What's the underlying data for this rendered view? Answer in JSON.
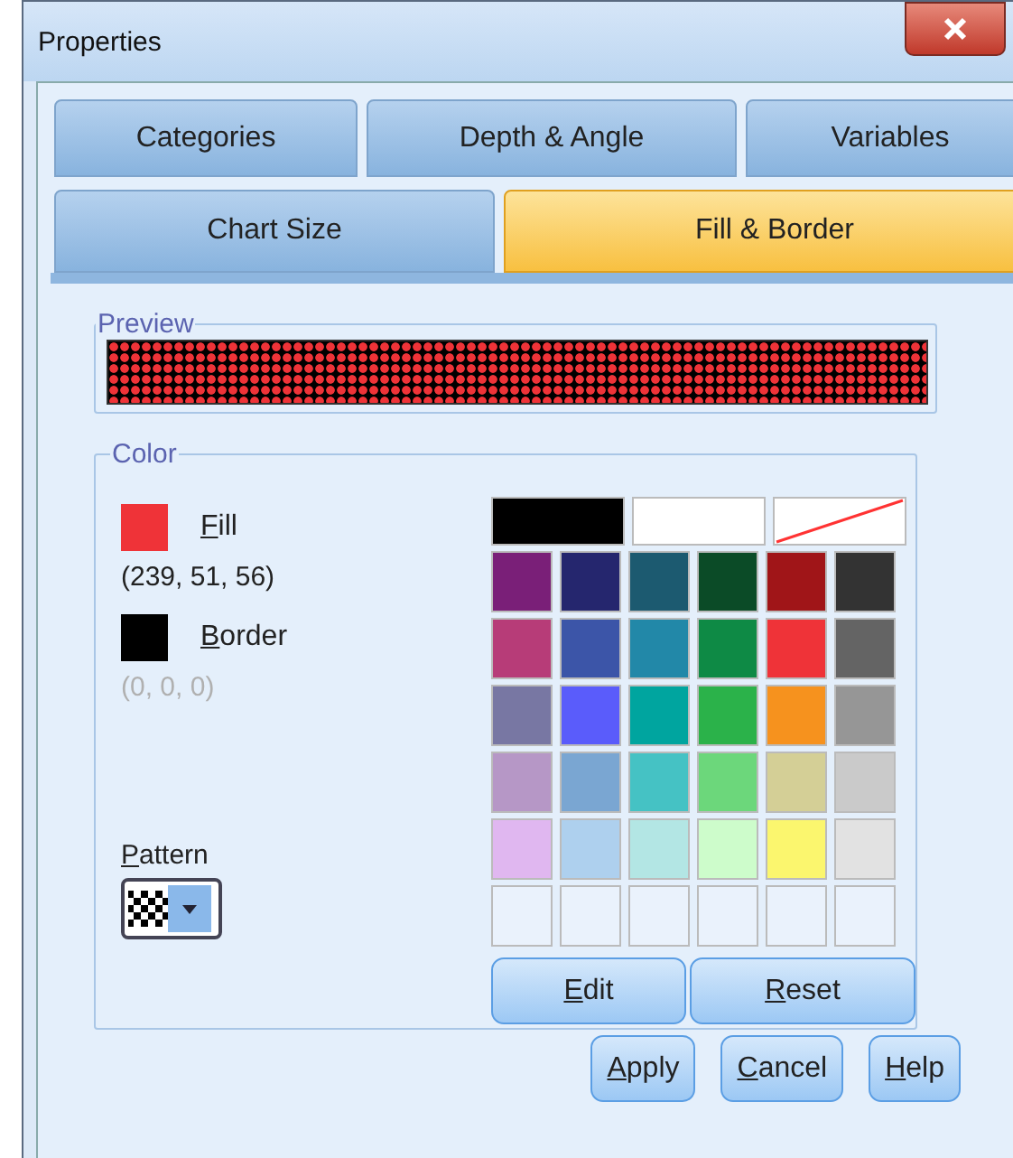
{
  "window": {
    "title": "Properties"
  },
  "tab_rows": [
    [
      {
        "label": "Categories",
        "selected": false
      },
      {
        "label": "Depth & Angle",
        "selected": false
      },
      {
        "label": "Variables",
        "selected": false
      }
    ],
    [
      {
        "label": "Chart Size",
        "selected": false
      },
      {
        "label": "Fill & Border",
        "selected": true
      }
    ]
  ],
  "preview": {
    "title": "Preview",
    "layers": [
      {
        "kind": "ground",
        "color": "#000000"
      },
      {
        "kind": "dots",
        "color": "#ef3338"
      }
    ]
  },
  "color_group": {
    "title": "Color",
    "targets": [
      {
        "label": "Fill",
        "color": "#ef3338",
        "value": "(239, 51, 56)",
        "dimmed": false
      },
      {
        "label": "Border",
        "color": "#000000",
        "value": "(0, 0, 0)",
        "dimmed": true
      }
    ],
    "pattern": {
      "label": "Pattern"
    },
    "palette": [
      [
        {
          "kind": "wide",
          "color": "#000000"
        },
        {
          "kind": "wide",
          "color": "#ffffff"
        },
        {
          "kind": "none"
        }
      ],
      [
        {
          "kind": "swatch",
          "color": "#7a1f78"
        },
        {
          "kind": "swatch",
          "color": "#25266e"
        },
        {
          "kind": "swatch",
          "color": "#1c5a70"
        },
        {
          "kind": "swatch",
          "color": "#0b4b27"
        },
        {
          "kind": "swatch",
          "color": "#a01518"
        },
        {
          "kind": "swatch",
          "color": "#333333"
        }
      ],
      [
        {
          "kind": "swatch",
          "color": "#b73c78"
        },
        {
          "kind": "swatch",
          "color": "#3c55a8"
        },
        {
          "kind": "swatch",
          "color": "#2288a8"
        },
        {
          "kind": "swatch",
          "color": "#0e8a45"
        },
        {
          "kind": "swatch",
          "color": "#ef3338"
        },
        {
          "kind": "swatch",
          "color": "#646464"
        }
      ],
      [
        {
          "kind": "swatch",
          "color": "#7877a3"
        },
        {
          "kind": "swatch",
          "color": "#5a5cfb"
        },
        {
          "kind": "swatch",
          "color": "#00a59f"
        },
        {
          "kind": "swatch",
          "color": "#2bb24a"
        },
        {
          "kind": "swatch",
          "color": "#f6921e"
        },
        {
          "kind": "swatch",
          "color": "#969696"
        }
      ],
      [
        {
          "kind": "swatch",
          "color": "#b697c6"
        },
        {
          "kind": "swatch",
          "color": "#7aa6d2"
        },
        {
          "kind": "swatch",
          "color": "#45c2c4"
        },
        {
          "kind": "swatch",
          "color": "#6cd77b"
        },
        {
          "kind": "swatch",
          "color": "#d4cf96"
        },
        {
          "kind": "swatch",
          "color": "#cacaca"
        }
      ],
      [
        {
          "kind": "swatch",
          "color": "#e0b7f0"
        },
        {
          "kind": "swatch",
          "color": "#aed0ee"
        },
        {
          "kind": "swatch",
          "color": "#b3e6e4"
        },
        {
          "kind": "swatch",
          "color": "#cdfccb"
        },
        {
          "kind": "swatch",
          "color": "#fbf66e"
        },
        {
          "kind": "swatch",
          "color": "#e2e2e2"
        }
      ],
      [
        {
          "kind": "empty"
        },
        {
          "kind": "empty"
        },
        {
          "kind": "empty"
        },
        {
          "kind": "empty"
        },
        {
          "kind": "empty"
        },
        {
          "kind": "empty"
        }
      ]
    ],
    "palette_buttons": [
      "Edit",
      "Reset"
    ]
  },
  "buttons": [
    "Apply",
    "Cancel",
    "Help"
  ]
}
